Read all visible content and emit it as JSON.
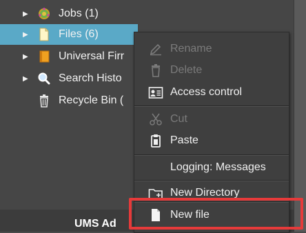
{
  "tree": {
    "items": [
      {
        "label": "Jobs (1)",
        "icon": "gear-icon",
        "expandable": true,
        "selected": false
      },
      {
        "label": "Files (6)",
        "icon": "file-icon",
        "expandable": true,
        "selected": true
      },
      {
        "label": "Universal Firr",
        "icon": "firmware-icon",
        "expandable": true,
        "selected": false
      },
      {
        "label": "Search Histo",
        "icon": "magnifier-icon",
        "expandable": true,
        "selected": false
      },
      {
        "label": "Recycle Bin (",
        "icon": "trash-icon",
        "expandable": false,
        "selected": false
      }
    ]
  },
  "context_menu": {
    "rename": "Rename",
    "delete": "Delete",
    "access_control": "Access control",
    "cut": "Cut",
    "paste": "Paste",
    "logging": "Logging: Messages",
    "new_directory": "New Directory",
    "new_file": "New file"
  },
  "footer": {
    "title": "UMS Ad"
  },
  "colors": {
    "selection": "#5aa9c7",
    "highlight": "#e63a3a",
    "menu_bg": "#3f3f3f"
  }
}
